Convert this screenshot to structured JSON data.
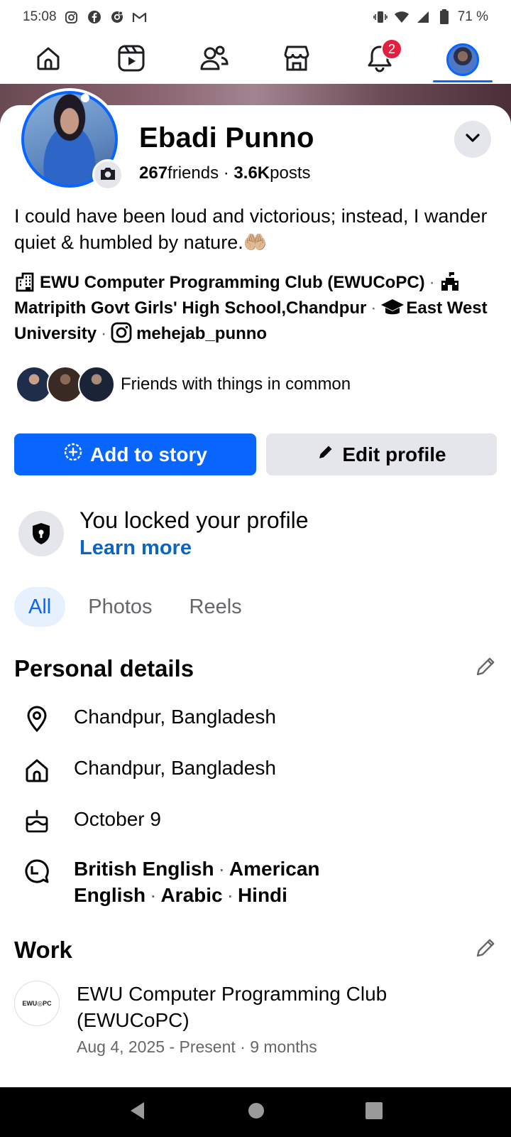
{
  "status_bar": {
    "time": "15:08",
    "battery": "71 %",
    "left_icons": [
      "instagram-icon",
      "facebook-icon",
      "threads-icon",
      "gmail-icon"
    ],
    "right_icons": [
      "vibrate-icon",
      "wifi-icon",
      "signal-icon",
      "battery-icon"
    ]
  },
  "top_nav": {
    "items": [
      "home-icon",
      "video-icon",
      "friends-icon",
      "marketplace-icon",
      "notifications-icon",
      "profile-avatar"
    ],
    "notification_count": "2",
    "active": "profile"
  },
  "profile": {
    "name": "Ebadi Punno",
    "friends_count": "267",
    "friends_label": "friends",
    "separator": " · ",
    "posts_count": "3.6K",
    "posts_label": "posts",
    "bio": "I could have been loud and victorious; instead, I wander quiet & humbled by nature.🤲🏼"
  },
  "details_line": {
    "work": "EWU Computer Programming  Club (EWUCoPC)",
    "school": "Matripith Govt Girls' High School,Chandpur",
    "university": "East West University",
    "instagram": "mehejab_punno",
    "dot": "·"
  },
  "mutual": {
    "text": "Friends with things in common"
  },
  "actions": {
    "add_story": "Add to story",
    "edit_profile": "Edit profile"
  },
  "lock": {
    "title": "You locked your profile",
    "link": "Learn more"
  },
  "tabs": [
    "All",
    "Photos",
    "Reels"
  ],
  "personal_details": {
    "title": "Personal details",
    "current_city": "Chandpur, Bangladesh",
    "hometown": "Chandpur, Bangladesh",
    "birthday": "October 9",
    "languages": [
      "British English",
      "American English",
      "Arabic",
      "Hindi"
    ],
    "dot": "·"
  },
  "work": {
    "title": "Work",
    "logo_text": "EWU◎PC",
    "org": "EWU Computer Programming  Club (EWUCoPC)",
    "dates": "Aug 4, 2025 - Present · 9 months"
  },
  "colors": {
    "accent": "#0866ff",
    "badge": "#e41e3f",
    "muted": "#65676b",
    "button_grey": "#e4e6eb"
  }
}
